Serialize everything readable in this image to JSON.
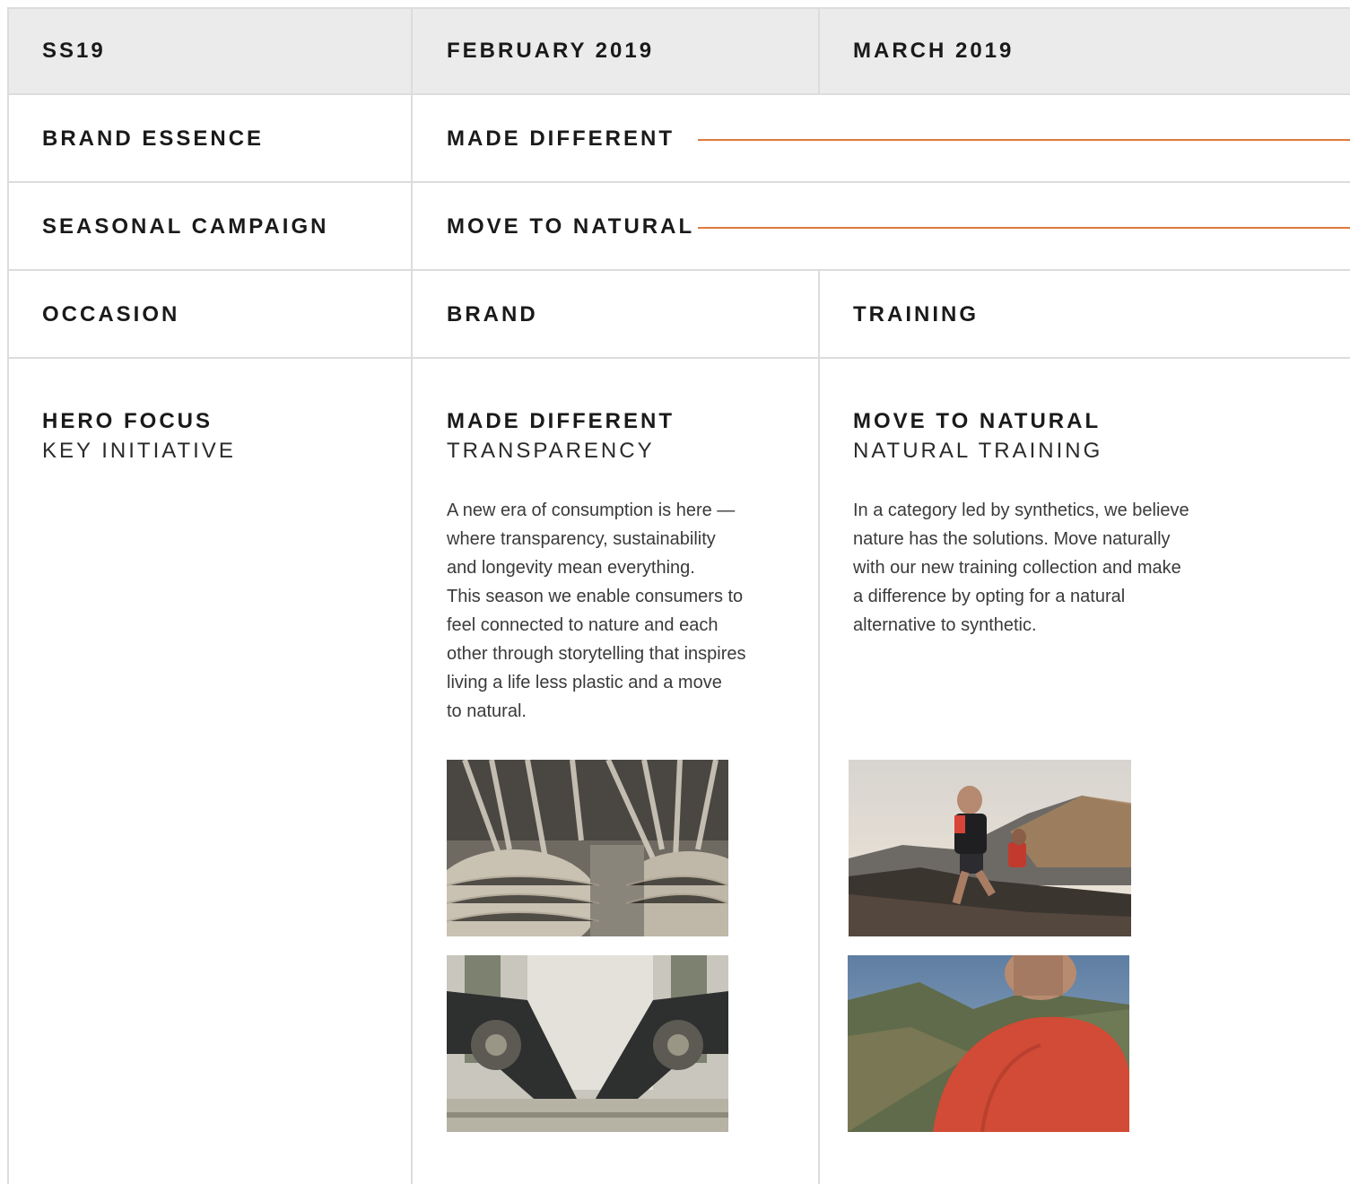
{
  "header": {
    "season": "SS19",
    "month_1": "FEBRUARY 2019",
    "month_2": "MARCH 2019"
  },
  "rows": {
    "brand_essence": {
      "label": "BRAND ESSENCE",
      "value": "MADE DIFFERENT"
    },
    "seasonal_campaign": {
      "label": "SEASONAL CAMPAIGN",
      "value": "MOVE TO NATURAL"
    },
    "occasion": {
      "label": "OCCASION",
      "value_1": "BRAND",
      "value_2": "TRAINING"
    },
    "hero": {
      "label": "HERO FOCUS",
      "sublabel": "KEY INITIATIVE"
    }
  },
  "columns": {
    "brand": {
      "title": "MADE DIFFERENT",
      "subtitle": "TRANSPARENCY",
      "body": "A new era of consumption is here —\nwhere transparency, sustainability\nand longevity mean everything.\nThis season we enable consumers to\nfeel connected to nature and each\nother through storytelling that inspires\nliving a life less plastic and a move\nto natural."
    },
    "training": {
      "title": "MOVE TO NATURAL",
      "subtitle": "NATURAL TRAINING",
      "body": "In a category led by synthetics, we believe\nnature has the solutions. Move naturally\nwith our new training collection and make\na difference by opting for a natural\nalternative to synthetic."
    }
  },
  "colors": {
    "accent_rule": "#e07a3c",
    "header_bg": "#ebebeb",
    "grid": "#dcdcdc"
  }
}
